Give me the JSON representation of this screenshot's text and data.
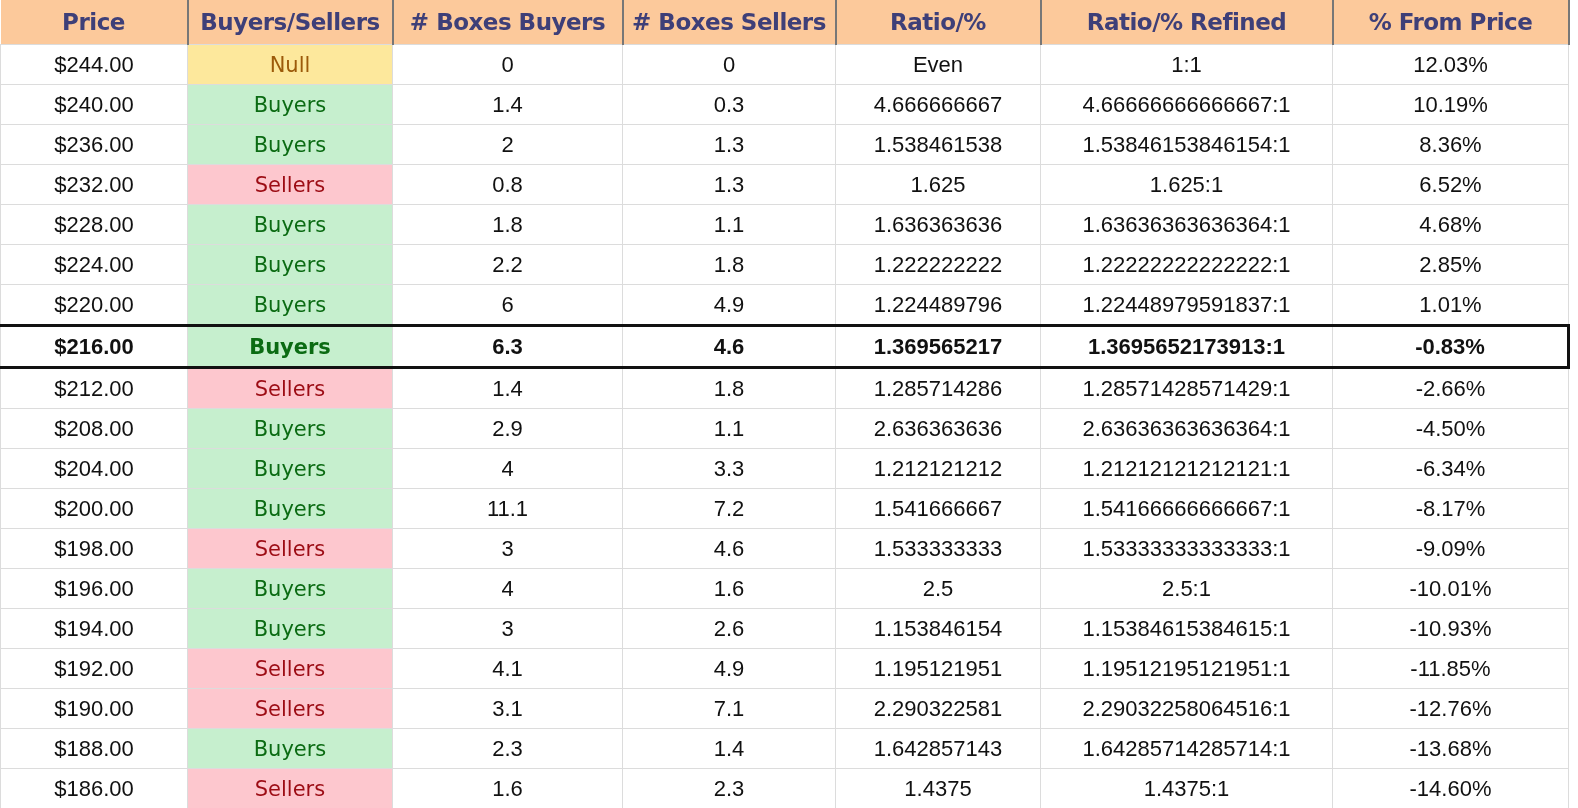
{
  "table": {
    "columns": [
      "Price",
      "Buyers/Sellers",
      "# Boxes Buyers",
      "# Boxes Sellers",
      "Ratio/%",
      "Ratio/% Refined",
      "% From Price"
    ],
    "rows": [
      {
        "selected": false,
        "kind": "null",
        "cells": [
          "$244.00",
          "Null",
          "0",
          "0",
          "Even",
          "1:1",
          "12.03%"
        ]
      },
      {
        "selected": false,
        "kind": "buyers",
        "cells": [
          "$240.00",
          "Buyers",
          "1.4",
          "0.3",
          "4.666666667",
          "4.66666666666667:1",
          "10.19%"
        ]
      },
      {
        "selected": false,
        "kind": "buyers",
        "cells": [
          "$236.00",
          "Buyers",
          "2",
          "1.3",
          "1.538461538",
          "1.53846153846154:1",
          "8.36%"
        ]
      },
      {
        "selected": false,
        "kind": "sellers",
        "cells": [
          "$232.00",
          "Sellers",
          "0.8",
          "1.3",
          "1.625",
          "1.625:1",
          "6.52%"
        ]
      },
      {
        "selected": false,
        "kind": "buyers",
        "cells": [
          "$228.00",
          "Buyers",
          "1.8",
          "1.1",
          "1.636363636",
          "1.63636363636364:1",
          "4.68%"
        ]
      },
      {
        "selected": false,
        "kind": "buyers",
        "cells": [
          "$224.00",
          "Buyers",
          "2.2",
          "1.8",
          "1.222222222",
          "1.22222222222222:1",
          "2.85%"
        ]
      },
      {
        "selected": false,
        "kind": "buyers",
        "cells": [
          "$220.00",
          "Buyers",
          "6",
          "4.9",
          "1.224489796",
          "1.22448979591837:1",
          "1.01%"
        ]
      },
      {
        "selected": true,
        "kind": "buyers",
        "cells": [
          "$216.00",
          "Buyers",
          "6.3",
          "4.6",
          "1.369565217",
          "1.3695652173913:1",
          "-0.83%"
        ]
      },
      {
        "selected": false,
        "kind": "sellers",
        "cells": [
          "$212.00",
          "Sellers",
          "1.4",
          "1.8",
          "1.285714286",
          "1.28571428571429:1",
          "-2.66%"
        ]
      },
      {
        "selected": false,
        "kind": "buyers",
        "cells": [
          "$208.00",
          "Buyers",
          "2.9",
          "1.1",
          "2.636363636",
          "2.63636363636364:1",
          "-4.50%"
        ]
      },
      {
        "selected": false,
        "kind": "buyers",
        "cells": [
          "$204.00",
          "Buyers",
          "4",
          "3.3",
          "1.212121212",
          "1.21212121212121:1",
          "-6.34%"
        ]
      },
      {
        "selected": false,
        "kind": "buyers",
        "cells": [
          "$200.00",
          "Buyers",
          "11.1",
          "7.2",
          "1.541666667",
          "1.54166666666667:1",
          "-8.17%"
        ]
      },
      {
        "selected": false,
        "kind": "sellers",
        "cells": [
          "$198.00",
          "Sellers",
          "3",
          "4.6",
          "1.533333333",
          "1.53333333333333:1",
          "-9.09%"
        ]
      },
      {
        "selected": false,
        "kind": "buyers",
        "cells": [
          "$196.00",
          "Buyers",
          "4",
          "1.6",
          "2.5",
          "2.5:1",
          "-10.01%"
        ]
      },
      {
        "selected": false,
        "kind": "buyers",
        "cells": [
          "$194.00",
          "Buyers",
          "3",
          "2.6",
          "1.153846154",
          "1.15384615384615:1",
          "-10.93%"
        ]
      },
      {
        "selected": false,
        "kind": "sellers",
        "cells": [
          "$192.00",
          "Sellers",
          "4.1",
          "4.9",
          "1.195121951",
          "1.19512195121951:1",
          "-11.85%"
        ]
      },
      {
        "selected": false,
        "kind": "sellers",
        "cells": [
          "$190.00",
          "Sellers",
          "3.1",
          "7.1",
          "2.290322581",
          "2.29032258064516:1",
          "-12.76%"
        ]
      },
      {
        "selected": false,
        "kind": "buyers",
        "cells": [
          "$188.00",
          "Buyers",
          "2.3",
          "1.4",
          "1.642857143",
          "1.64285714285714:1",
          "-13.68%"
        ]
      },
      {
        "selected": false,
        "kind": "sellers",
        "cells": [
          "$186.00",
          "Sellers",
          "1.6",
          "2.3",
          "1.4375",
          "1.4375:1",
          "-14.60%"
        ]
      }
    ]
  }
}
